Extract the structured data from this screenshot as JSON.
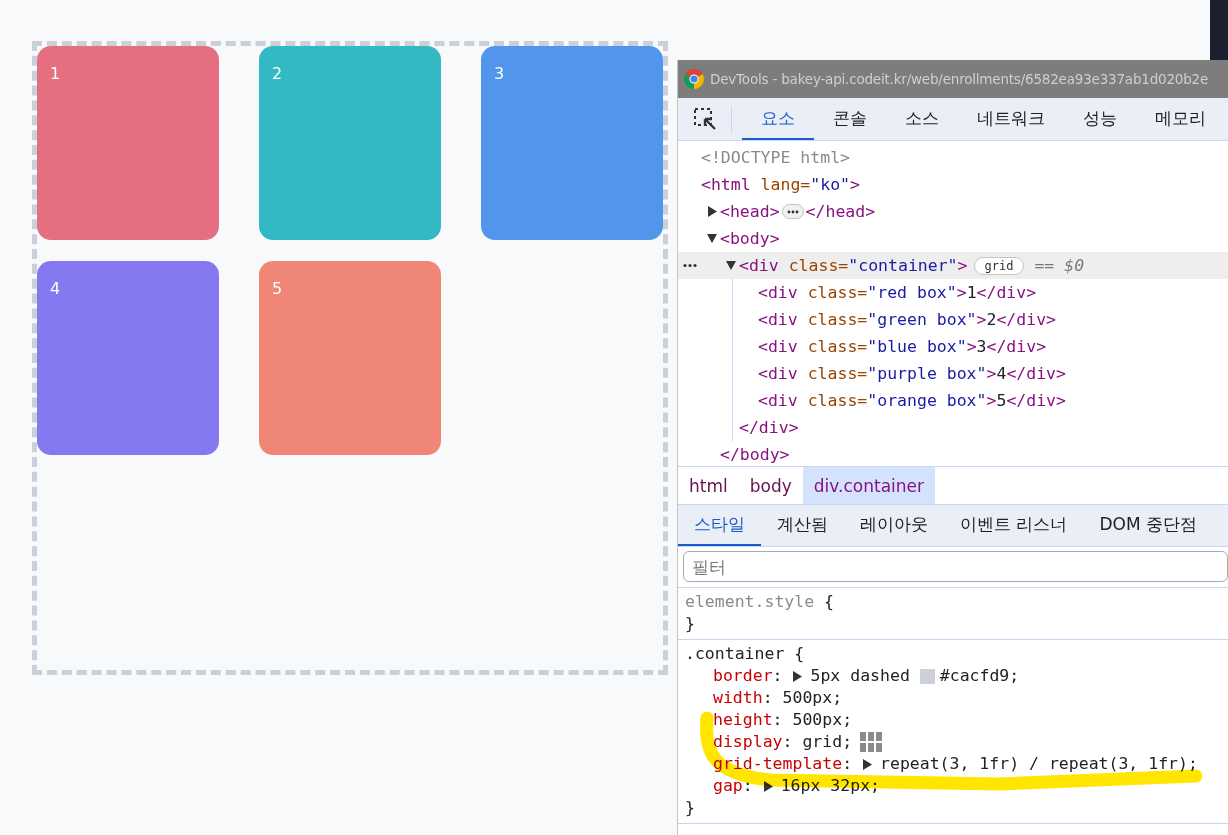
{
  "page": {
    "boxes": [
      {
        "label": "1",
        "color": "#e56e80"
      },
      {
        "label": "2",
        "color": "#33b9c4"
      },
      {
        "label": "3",
        "color": "#5295ec"
      },
      {
        "label": "4",
        "color": "#8479ee"
      },
      {
        "label": "5",
        "color": "#f08676"
      }
    ]
  },
  "devtools": {
    "title": "DevTools - bakey-api.codeit.kr/web/enrollments/6582ea93e337ab1d020b2e",
    "tabs": [
      {
        "label": "요소",
        "selected": true
      },
      {
        "label": "콘솔",
        "selected": false
      },
      {
        "label": "소스",
        "selected": false
      },
      {
        "label": "네트워크",
        "selected": false
      },
      {
        "label": "성능",
        "selected": false
      },
      {
        "label": "메모리",
        "selected": false
      }
    ],
    "dom": [
      {
        "selected": false,
        "tokens": [
          {
            "kind": "doctype",
            "text": "<!DOCTYPE html>"
          }
        ]
      },
      {
        "selected": false,
        "tokens": [
          {
            "kind": "tag",
            "text": "<html "
          },
          {
            "kind": "attr",
            "text": "lang="
          },
          {
            "kind": "value",
            "text": "\"ko\""
          },
          {
            "kind": "tag",
            "text": ">"
          }
        ],
        "children": [
          {
            "expanded": false,
            "selected": false,
            "tokens": [
              {
                "kind": "tag",
                "text": "<head>"
              }
            ],
            "close": [
              {
                "kind": "tag",
                "text": "</head>"
              }
            ]
          },
          {
            "expanded": true,
            "selected": false,
            "tokens": [
              {
                "kind": "tag",
                "text": "<body>"
              }
            ],
            "close": [
              {
                "kind": "tag",
                "text": "</body>"
              }
            ],
            "children": [
              {
                "expanded": true,
                "selected": true,
                "badge": "grid",
                "suffix": "== $0",
                "tokens": [
                  {
                    "kind": "tag",
                    "text": "<div "
                  },
                  {
                    "kind": "attr",
                    "text": "class="
                  },
                  {
                    "kind": "value",
                    "text": "\"container\""
                  },
                  {
                    "kind": "tag",
                    "text": ">"
                  }
                ],
                "close": [
                  {
                    "kind": "tag",
                    "text": "</div>"
                  }
                ],
                "children": [
                  {
                    "selected": false,
                    "tokens": [
                      {
                        "kind": "tag",
                        "text": "<div "
                      },
                      {
                        "kind": "attr",
                        "text": "class="
                      },
                      {
                        "kind": "value",
                        "text": "\"red box\""
                      },
                      {
                        "kind": "tag",
                        "text": ">"
                      },
                      {
                        "kind": "text",
                        "text": "1"
                      },
                      {
                        "kind": "tag",
                        "text": "</div>"
                      }
                    ]
                  },
                  {
                    "selected": false,
                    "tokens": [
                      {
                        "kind": "tag",
                        "text": "<div "
                      },
                      {
                        "kind": "attr",
                        "text": "class="
                      },
                      {
                        "kind": "value",
                        "text": "\"green box\""
                      },
                      {
                        "kind": "tag",
                        "text": ">"
                      },
                      {
                        "kind": "text",
                        "text": "2"
                      },
                      {
                        "kind": "tag",
                        "text": "</div>"
                      }
                    ]
                  },
                  {
                    "selected": false,
                    "tokens": [
                      {
                        "kind": "tag",
                        "text": "<div "
                      },
                      {
                        "kind": "attr",
                        "text": "class="
                      },
                      {
                        "kind": "value",
                        "text": "\"blue box\""
                      },
                      {
                        "kind": "tag",
                        "text": ">"
                      },
                      {
                        "kind": "text",
                        "text": "3"
                      },
                      {
                        "kind": "tag",
                        "text": "</div>"
                      }
                    ]
                  },
                  {
                    "selected": false,
                    "tokens": [
                      {
                        "kind": "tag",
                        "text": "<div "
                      },
                      {
                        "kind": "attr",
                        "text": "class="
                      },
                      {
                        "kind": "value",
                        "text": "\"purple box\""
                      },
                      {
                        "kind": "tag",
                        "text": ">"
                      },
                      {
                        "kind": "text",
                        "text": "4"
                      },
                      {
                        "kind": "tag",
                        "text": "</div>"
                      }
                    ]
                  },
                  {
                    "selected": false,
                    "tokens": [
                      {
                        "kind": "tag",
                        "text": "<div "
                      },
                      {
                        "kind": "attr",
                        "text": "class="
                      },
                      {
                        "kind": "value",
                        "text": "\"orange box\""
                      },
                      {
                        "kind": "tag",
                        "text": ">"
                      },
                      {
                        "kind": "text",
                        "text": "5"
                      },
                      {
                        "kind": "tag",
                        "text": "</div>"
                      }
                    ]
                  }
                ]
              }
            ]
          }
        ]
      }
    ],
    "breadcrumbs": [
      {
        "label": "html",
        "selected": false
      },
      {
        "label": "body",
        "selected": false
      },
      {
        "label": "div.container",
        "selected": true
      }
    ],
    "style_tabs": [
      {
        "label": "스타일",
        "selected": true
      },
      {
        "label": "계산됨",
        "selected": false
      },
      {
        "label": "레이아웃",
        "selected": false
      },
      {
        "label": "이벤트 리스너",
        "selected": false
      },
      {
        "label": "DOM 중단점",
        "selected": false
      }
    ],
    "filter": {
      "placeholder": "필터"
    },
    "rules": [
      {
        "kind": "inline",
        "selector": "element.style",
        "open": " {",
        "close": "}"
      },
      {
        "kind": "normal",
        "selector": ".container",
        "open": " {",
        "close": "}",
        "properties": [
          {
            "tokens": [
              {
                "kind": "name",
                "text": "border"
              },
              {
                "kind": "punct",
                "text": ": "
              },
              {
                "kind": "arrow"
              },
              {
                "kind": "value",
                "text": "5px dashed "
              },
              {
                "kind": "swatch",
                "color": "#cacfd9"
              },
              {
                "kind": "value",
                "text": "#cacfd9;"
              }
            ]
          },
          {
            "tokens": [
              {
                "kind": "name",
                "text": "width"
              },
              {
                "kind": "punct",
                "text": ": "
              },
              {
                "kind": "value",
                "text": "500px;"
              }
            ]
          },
          {
            "tokens": [
              {
                "kind": "name",
                "text": "height"
              },
              {
                "kind": "punct",
                "text": ": "
              },
              {
                "kind": "value",
                "text": "500px;"
              }
            ]
          },
          {
            "tokens": [
              {
                "kind": "name",
                "text": "display"
              },
              {
                "kind": "punct",
                "text": ": "
              },
              {
                "kind": "value",
                "text": "grid;"
              },
              {
                "kind": "grid-icon"
              }
            ]
          },
          {
            "tokens": [
              {
                "kind": "name",
                "text": "grid-template"
              },
              {
                "kind": "punct",
                "text": ": "
              },
              {
                "kind": "arrow"
              },
              {
                "kind": "value",
                "text": "repeat(3, 1fr) / repeat(3, 1fr);"
              }
            ]
          },
          {
            "tokens": [
              {
                "kind": "name",
                "text": "gap"
              },
              {
                "kind": "punct",
                "text": ": "
              },
              {
                "kind": "arrow"
              },
              {
                "kind": "value",
                "text": "16px 32px;"
              }
            ]
          }
        ]
      }
    ]
  }
}
